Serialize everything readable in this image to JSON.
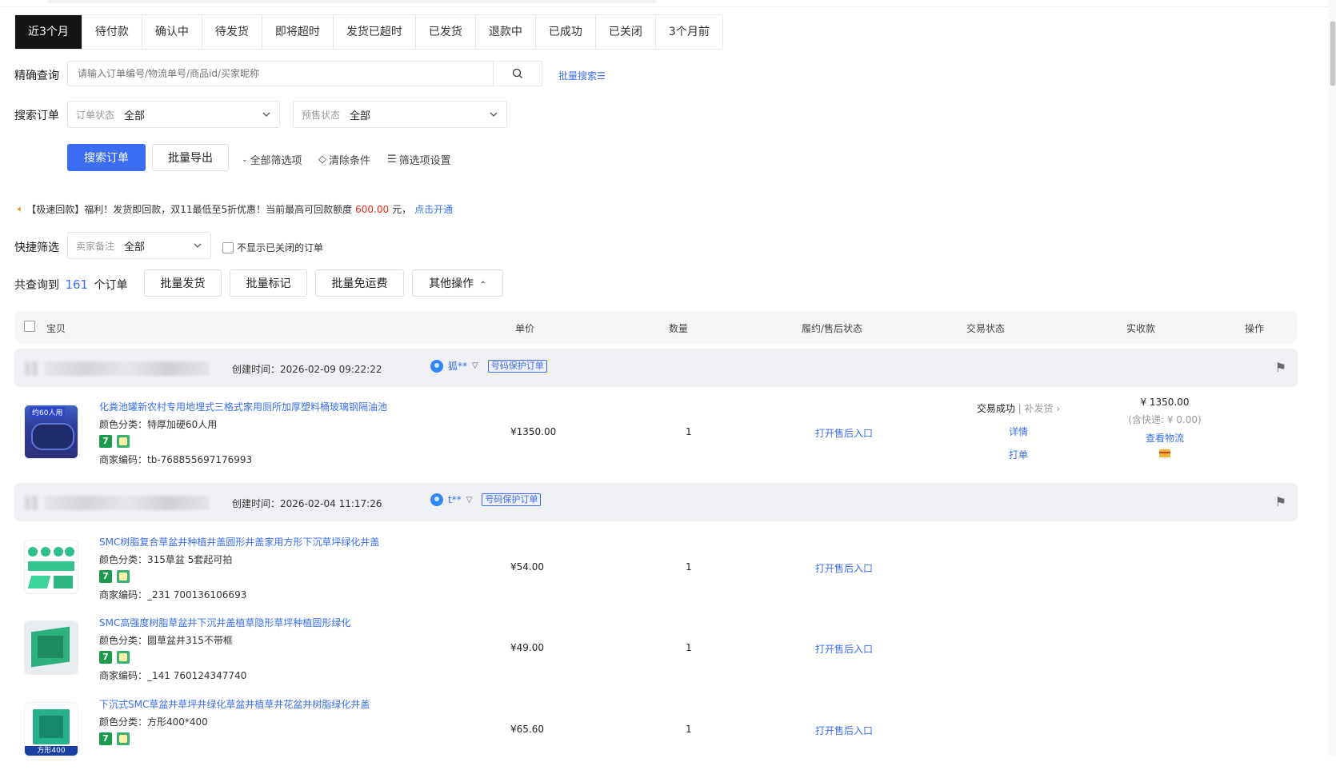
{
  "tabs": [
    "近3个月",
    "待付款",
    "确认中",
    "待发货",
    "即将超时",
    "发货已超时",
    "已发货",
    "退款中",
    "已成功",
    "已关闭",
    "3个月前"
  ],
  "search": {
    "label": "精确查询",
    "placeholder": "请输入订单编号/物流单号/商品id/买家昵称",
    "bulk_search": "批量搜索"
  },
  "filter": {
    "label": "搜索订单",
    "order_status_label": "订单状态",
    "order_status_value": "全部",
    "presale_label": "预售状态",
    "presale_value": "全部"
  },
  "actions": {
    "search_btn": "搜索订单",
    "export_btn": "批量导出",
    "all_filters": "全部筛选项",
    "clear": "清除条件",
    "filter_settings": "筛选项设置"
  },
  "notice": {
    "text_a": "【极速回款】福利！发货即回款，双11最低至5折优惠！当前最高可回款额度",
    "amount": "600.00",
    "unit": "元，",
    "link": "点击开通"
  },
  "quick": {
    "label": "快捷筛选",
    "remark_label": "卖家备注",
    "remark_value": "全部",
    "hide_closed": "不显示已关闭的订单"
  },
  "summary": {
    "prefix": "共查询到",
    "count": "161",
    "suffix": "个订单",
    "btn_ship": "批量发货",
    "btn_mark": "批量标记",
    "btn_free": "批量免运费",
    "btn_other": "其他操作"
  },
  "table_headers": {
    "item": "宝贝",
    "price": "单价",
    "qty": "数量",
    "after": "履约/售后状态",
    "trade": "交易状态",
    "paid": "实收款",
    "ops": "操作"
  },
  "colors": {
    "accent": "#3d6cf4",
    "active_tab": "#141414",
    "link": "#3a6df0",
    "red": "#e5281d"
  },
  "orders": [
    {
      "created_label": "创建时间：",
      "created": "2026-02-09 09:22:22",
      "buyer": "狐**",
      "tag": "号码保护订单",
      "items": [
        {
          "title": "化粪池罐新农村专用地埋式三格式家用厕所加厚塑料桶玻璃钢隔油池",
          "sku": "颜色分类：特厚加硬60人用",
          "code": "商家编码：tb-768855697176993",
          "price": "¥1350.00",
          "qty": "1",
          "after": "打开售后入口"
        }
      ],
      "status": "交易成功",
      "status_sub": "补发货",
      "detail": "详情",
      "print": "打单",
      "amount": "¥ 1350.00",
      "ship": "(含快递: ¥ 0.00)",
      "logistics": "查看物流"
    },
    {
      "created_label": "创建时间：",
      "created": "2026-02-04 11:17:26",
      "buyer": "t**",
      "tag": "号码保护订单",
      "items": [
        {
          "title": "SMC树脂复合草盆井种植井盖圆形井盖家用方形下沉草坪绿化井盖",
          "sku": "颜色分类：315草盆 5套起可拍",
          "code": "商家编码：_231 700136106693",
          "price": "¥54.00",
          "qty": "1",
          "after": "打开售后入口"
        },
        {
          "title": "SMC高强度树脂草盆井下沉井盖植草隐形草坪种植圆形绿化",
          "sku": "颜色分类：圆草盆井315不带框",
          "code": "商家编码：_141 760124347740",
          "price": "¥49.00",
          "qty": "1",
          "after": "打开售后入口"
        },
        {
          "title": "下沉式SMC草盆井草坪井绿化草盆井植草井花盆井树脂绿化井盖",
          "sku": "颜色分类：方形400*400",
          "code": "",
          "price": "¥65.60",
          "qty": "1",
          "after": "打开售后入口"
        }
      ]
    }
  ],
  "thumb_text": {
    "t1": "约60人用",
    "t4": "方形400"
  }
}
